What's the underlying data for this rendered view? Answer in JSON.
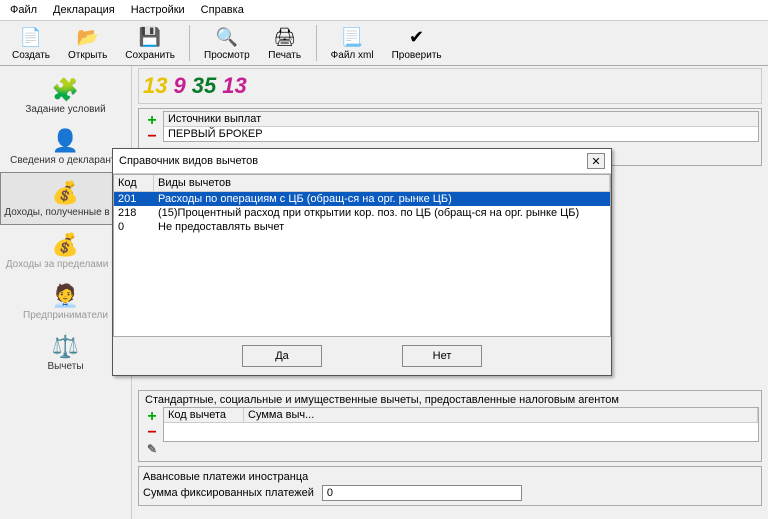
{
  "menu": {
    "file": "Файл",
    "decl": "Декларация",
    "settings": "Настройки",
    "help": "Справка"
  },
  "toolbar": {
    "create": "Создать",
    "open": "Открыть",
    "save": "Сохранить",
    "preview": "Просмотр",
    "print": "Печать",
    "xml": "Файл xml",
    "check": "Проверить"
  },
  "sidebar": {
    "conditions": "Задание условий",
    "declinfo": "Сведения о декларанте",
    "income_in": "Доходы, полученные в РФ",
    "income_out": "Доходы за пределами РФ",
    "entrepreneur": "Предприниматели",
    "deductions": "Вычеты"
  },
  "rates": [
    "13",
    "9",
    "35",
    "13"
  ],
  "rate_colors": [
    "#e6c200",
    "#c61f92",
    "#0a7a2a",
    "#c61f92"
  ],
  "sources": {
    "header": "Источники выплат",
    "items": [
      "ПЕРВЫЙ БРОКЕР"
    ]
  },
  "deductions_block": {
    "title": "Стандартные, социальные и имущественные вычеты, предоставленные налоговым агентом",
    "col_code": "Код вычета",
    "col_sum": "Сумма выч..."
  },
  "advance": {
    "title": "Авансовые платежи иностранца",
    "label": "Сумма фиксированных платежей",
    "value": "0"
  },
  "dialog": {
    "title": "Справочник видов вычетов",
    "col_code": "Код",
    "col_type": "Виды вычетов",
    "rows": [
      {
        "code": "201",
        "type": "Расходы по операциям с ЦБ (обращ-ся на орг. рынке ЦБ)",
        "selected": true
      },
      {
        "code": "218",
        "type": "(15)Процентный расход при открытии кор. поз. по ЦБ (обращ-ся на орг. рынке ЦБ)",
        "selected": false
      },
      {
        "code": "0",
        "type": "Не предоставлять вычет",
        "selected": false
      }
    ],
    "yes": "Да",
    "no": "Нет"
  }
}
